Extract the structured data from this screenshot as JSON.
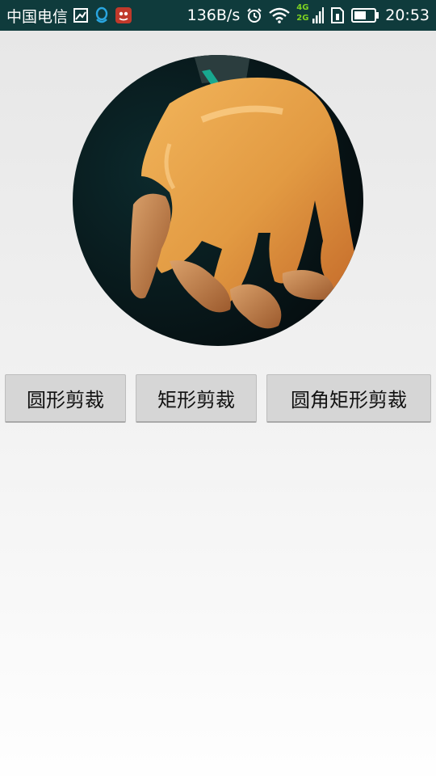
{
  "status_bar": {
    "carrier": "中国电信",
    "speed": "136B/s",
    "time": "20:53",
    "icons": [
      "gallery-icon",
      "qq-icon",
      "app-icon",
      "alarm-icon",
      "wifi-icon",
      "signal-4g-2g-icon",
      "sim-icon",
      "battery-icon"
    ],
    "network_labels": {
      "top": "4G",
      "bottom": "2G"
    }
  },
  "buttons": {
    "circle_crop": "圆形剪裁",
    "rect_crop": "矩形剪裁",
    "rounded_rect_crop": "圆角矩形剪裁"
  },
  "colors": {
    "status_bar_bg": "#0f3b3c",
    "button_bg": "#d6d6d6",
    "accent_green": "#7ed321"
  }
}
